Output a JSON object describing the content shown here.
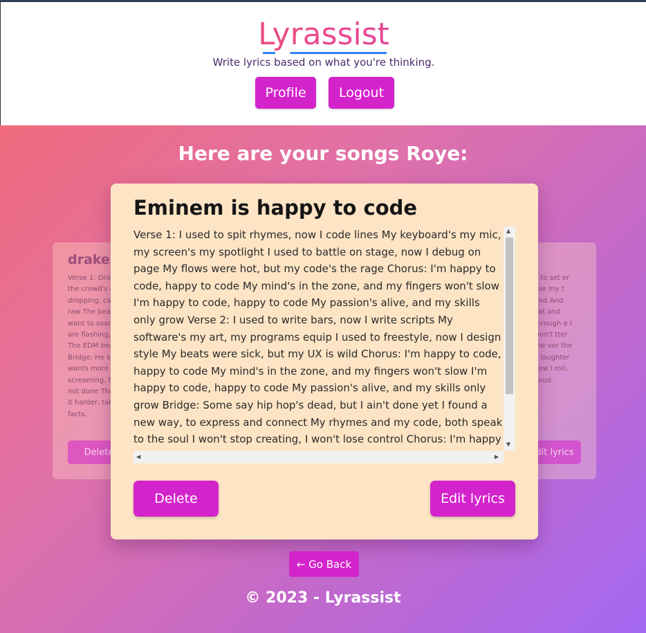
{
  "app": {
    "logo": "Lyrassist",
    "tagline": "Write lyrics based on what you're thinking."
  },
  "nav": {
    "profile_label": "Profile",
    "logout_label": "Logout"
  },
  "main": {
    "heading": "Here are your songs Roye:",
    "side_left": {
      "title": "drake s",
      "text": "Verse 1: Drak the crowd's g dropping, ca raw The beat want to soar are flashing, The EDM bea Bridge: He sc wants more T screaming, th not done The it harder, tak facts.",
      "delete_label": "Delete"
    },
    "side_right": {
      "text": "e to set er use my t And And eat and through e I won't tter the ver the d laughter how I roll, good",
      "edit_label": "dit lyrics"
    },
    "card": {
      "title": "Eminem is happy to code",
      "lyrics": "Verse 1: I used to spit rhymes, now I code lines My keyboard's my mic, my screen's my spotlight I used to battle on stage, now I debug on page My flows were hot, but my code's the rage Chorus: I'm happy to code, happy to code My mind's in the zone, and my fingers won't slow I'm happy to code, happy to code My passion's alive, and my skills only grow Verse 2: I used to write bars, now I write scripts My software's my art, my programs equip I used to freestyle, now I design style My beats were sick, but my UX is wild Chorus: I'm happy to code, happy to code My mind's in the zone, and my fingers won't slow I'm happy to code, happy to code My passion's alive, and my skills only grow Bridge: Some say hip hop's dead, but I ain't done yet I found a new way, to express and connect My rhymes and my code, both speak to the soul I won't stop creating, I won't lose control Chorus: I'm happy to code, happy to code My mind's in the zone, and my fingers won't slow",
      "delete_label": "Delete",
      "edit_label": "Edit lyrics"
    },
    "back_label": "← Go Back"
  },
  "footer": {
    "text": "© 2023 - Lyrassist"
  },
  "colors": {
    "accent": "#d324cc",
    "card_bg": "#fde4c5"
  }
}
